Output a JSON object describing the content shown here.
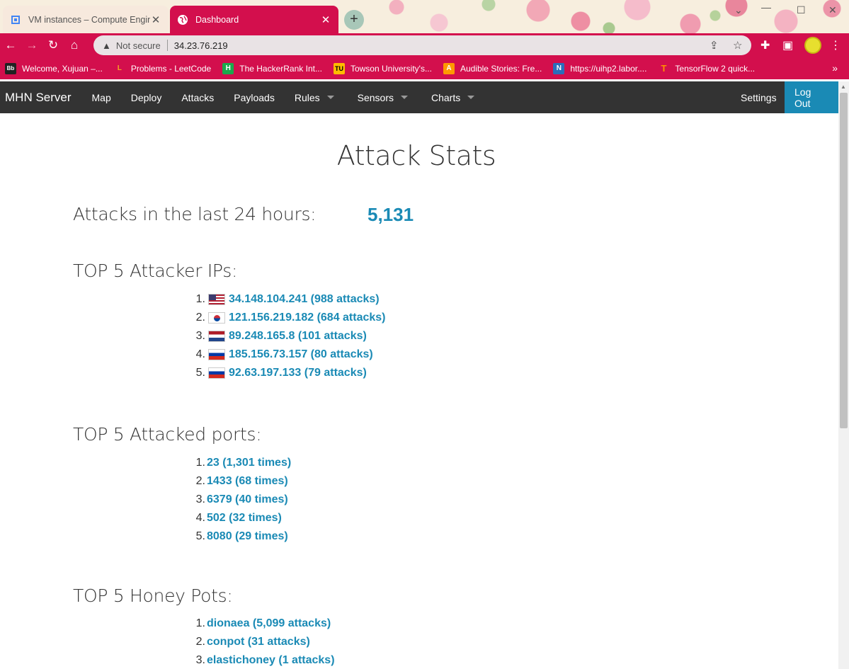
{
  "browser": {
    "tabs": [
      {
        "title": "VM instances – Compute Engine",
        "active": false
      },
      {
        "title": "Dashboard",
        "active": true
      }
    ],
    "address": {
      "security": "Not secure",
      "url": "34.23.76.219"
    },
    "bookmarks": [
      {
        "label": "Welcome, Xujuan –...",
        "icon": "Bb"
      },
      {
        "label": "Problems - LeetCode",
        "icon": "L"
      },
      {
        "label": "The HackerRank Int...",
        "icon": "H"
      },
      {
        "label": "Towson University's...",
        "icon": "TU"
      },
      {
        "label": "Audible Stories: Fre...",
        "icon": "A"
      },
      {
        "label": "https://uihp2.labor....",
        "icon": "N"
      },
      {
        "label": "TensorFlow 2 quick...",
        "icon": "T"
      }
    ],
    "bookmarks_more": "»"
  },
  "nav": {
    "brand": "MHN Server",
    "items": [
      "Map",
      "Deploy",
      "Attacks",
      "Payloads",
      "Rules",
      "Sensors",
      "Charts"
    ],
    "settings": "Settings",
    "logout": "Log Out"
  },
  "page": {
    "title": "Attack Stats",
    "attacks_label": "Attacks in the last 24 hours:",
    "attacks_count": "5,131",
    "top_ips": {
      "heading": "TOP 5 Attacker IPs:",
      "items": [
        {
          "num": "1.",
          "flag": "us",
          "text": "34.148.104.241 (988 attacks)"
        },
        {
          "num": "2.",
          "flag": "kr",
          "text": "121.156.219.182 (684 attacks)"
        },
        {
          "num": "3.",
          "flag": "nl",
          "text": "89.248.165.8 (101 attacks)"
        },
        {
          "num": "4.",
          "flag": "ru",
          "text": "185.156.73.157 (80 attacks)"
        },
        {
          "num": "5.",
          "flag": "ru",
          "text": "92.63.197.133 (79 attacks)"
        }
      ]
    },
    "top_ports": {
      "heading": "TOP 5 Attacked ports:",
      "items": [
        {
          "num": "1.",
          "text": "23 (1,301 times)"
        },
        {
          "num": "2.",
          "text": "1433 (68 times)"
        },
        {
          "num": "3.",
          "text": "6379 (40 times)"
        },
        {
          "num": "4.",
          "text": "502 (32 times)"
        },
        {
          "num": "5.",
          "text": "8080 (29 times)"
        }
      ]
    },
    "top_honeypots": {
      "heading": "TOP 5 Honey Pots:",
      "items": [
        {
          "num": "1.",
          "text": "dionaea (5,099 attacks)"
        },
        {
          "num": "2.",
          "text": "conpot (31 attacks)"
        },
        {
          "num": "3.",
          "text": "elastichoney (1 attacks)"
        }
      ]
    }
  },
  "colors": {
    "accent": "#1a8ab5",
    "navbar": "#333333",
    "browser_theme": "#d30f4d"
  }
}
